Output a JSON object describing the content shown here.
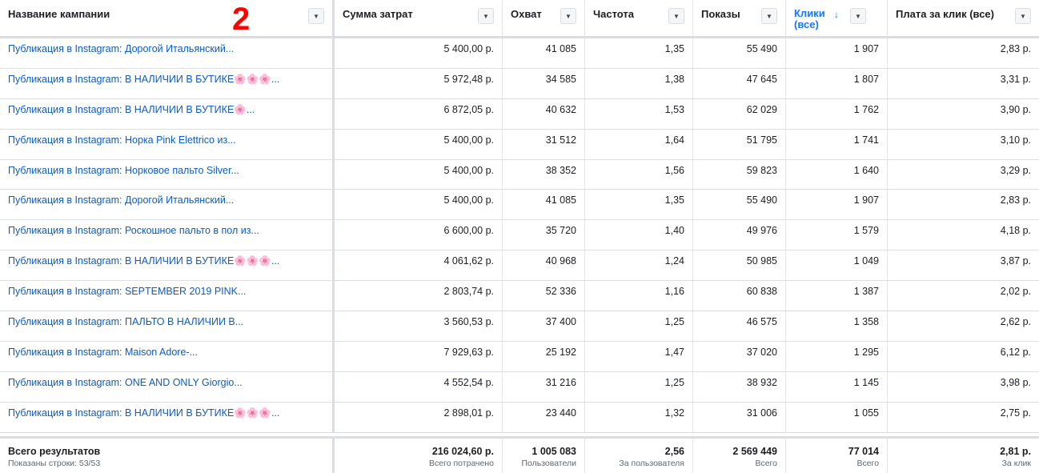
{
  "header": {
    "annotation": "2",
    "columns": [
      {
        "label": "Название кампании"
      },
      {
        "label": "Сумма затрат"
      },
      {
        "label": "Охват"
      },
      {
        "label": "Частота"
      },
      {
        "label": "Показы"
      },
      {
        "label": "Клики (все)"
      },
      {
        "label": "Плата за клик (все)"
      }
    ]
  },
  "rows": [
    {
      "name": "Публикация в Instagram: Дорогой Итальянский...",
      "spend": "5 400,00 р.",
      "reach": "41 085",
      "freq": "1,35",
      "impr": "55 490",
      "clicks": "1 907",
      "cpc": "2,83 р."
    },
    {
      "name": "Публикация в Instagram: В НАЛИЧИИ В БУТИКЕ🌸🌸🌸...",
      "spend": "5 972,48 р.",
      "reach": "34 585",
      "freq": "1,38",
      "impr": "47 645",
      "clicks": "1 807",
      "cpc": "3,31 р."
    },
    {
      "name": "Публикация в Instagram: В НАЛИЧИИ В БУТИКЕ🌸...",
      "spend": "6 872,05 р.",
      "reach": "40 632",
      "freq": "1,53",
      "impr": "62 029",
      "clicks": "1 762",
      "cpc": "3,90 р."
    },
    {
      "name": "Публикация в Instagram: Норка Pink Elettrico из...",
      "spend": "5 400,00 р.",
      "reach": "31 512",
      "freq": "1,64",
      "impr": "51 795",
      "clicks": "1 741",
      "cpc": "3,10 р."
    },
    {
      "name": "Публикация в Instagram: Норковое пальто Silver...",
      "spend": "5 400,00 р.",
      "reach": "38 352",
      "freq": "1,56",
      "impr": "59 823",
      "clicks": "1 640",
      "cpc": "3,29 р."
    },
    {
      "name": "Публикация в Instagram: Дорогой Итальянский...",
      "spend": "5 400,00 р.",
      "reach": "41 085",
      "freq": "1,35",
      "impr": "55 490",
      "clicks": "1 907",
      "cpc": "2,83 р."
    },
    {
      "name": "Публикация в Instagram: Роскошное пальто в пол из...",
      "spend": "6 600,00 р.",
      "reach": "35 720",
      "freq": "1,40",
      "impr": "49 976",
      "clicks": "1 579",
      "cpc": "4,18 р."
    },
    {
      "name": "Публикация в Instagram: В НАЛИЧИИ В БУТИКЕ🌸🌸🌸...",
      "spend": "4 061,62 р.",
      "reach": "40 968",
      "freq": "1,24",
      "impr": "50 985",
      "clicks": "1 049",
      "cpc": "3,87 р."
    },
    {
      "name": "Публикация в Instagram: SEPTEMBER 2019 PINK...",
      "spend": "2 803,74 р.",
      "reach": "52 336",
      "freq": "1,16",
      "impr": "60 838",
      "clicks": "1 387",
      "cpc": "2,02 р."
    },
    {
      "name": "Публикация в Instagram: ПАЛЬТО В НАЛИЧИИ В...",
      "spend": "3 560,53 р.",
      "reach": "37 400",
      "freq": "1,25",
      "impr": "46 575",
      "clicks": "1 358",
      "cpc": "2,62 р."
    },
    {
      "name": "Публикация в Instagram: Maison Adore-...",
      "spend": "7 929,63 р.",
      "reach": "25 192",
      "freq": "1,47",
      "impr": "37 020",
      "clicks": "1 295",
      "cpc": "6,12 р."
    },
    {
      "name": "Публикация в Instagram: ONE AND ONLY Giorgio...",
      "spend": "4 552,54 р.",
      "reach": "31 216",
      "freq": "1,25",
      "impr": "38 932",
      "clicks": "1 145",
      "cpc": "3,98 р."
    },
    {
      "name": "Публикация в Instagram: В НАЛИЧИИ В БУТИКЕ🌸🌸🌸...",
      "spend": "2 898,01 р.",
      "reach": "23 440",
      "freq": "1,32",
      "impr": "31 006",
      "clicks": "1 055",
      "cpc": "2,75 р."
    }
  ],
  "footer": {
    "title": "Всего результатов",
    "rows_shown": "Показаны строки: 53/53",
    "spend": {
      "value": "216 024,60 р.",
      "sub": "Всего потрачено"
    },
    "reach": {
      "value": "1 005 083",
      "sub": "Пользователи"
    },
    "freq": {
      "value": "2,56",
      "sub": "За пользователя"
    },
    "impr": {
      "value": "2 569 449",
      "sub": "Всего"
    },
    "clicks": {
      "value": "77 014",
      "sub": "Всего"
    },
    "cpc": {
      "value": "2,81 р.",
      "sub": "За клик"
    }
  },
  "icons": {
    "dropdown": "chevron-down-icon",
    "sort": "sort-descending-icon"
  },
  "colors": {
    "link": "#0b5cc5",
    "sorted_header": "#1877f2",
    "annotation": "#ff0000"
  }
}
